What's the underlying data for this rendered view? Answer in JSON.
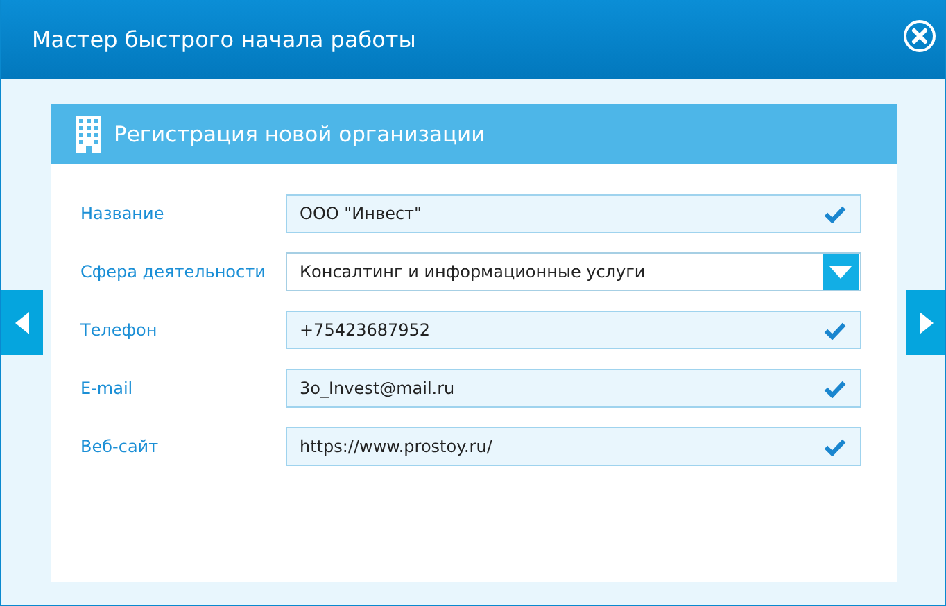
{
  "window": {
    "title": "Мастер быстрого начала работы"
  },
  "panel": {
    "title": "Регистрация новой организации"
  },
  "fields": [
    {
      "label": "Название",
      "kind": "text",
      "value": "ООО \"Инвест\"",
      "valid": true
    },
    {
      "label": "Сфера деятельности",
      "kind": "select",
      "value": "Консалтинг и информационные услуги"
    },
    {
      "label": "Телефон",
      "kind": "text",
      "value": "+75423687952",
      "valid": true
    },
    {
      "label": "E-mail",
      "kind": "text",
      "value": "3o_Invest@mail.ru",
      "valid": true
    },
    {
      "label": "Веб-сайт",
      "kind": "text",
      "value": "https://www.prostoy.ru/",
      "valid": true
    }
  ]
}
